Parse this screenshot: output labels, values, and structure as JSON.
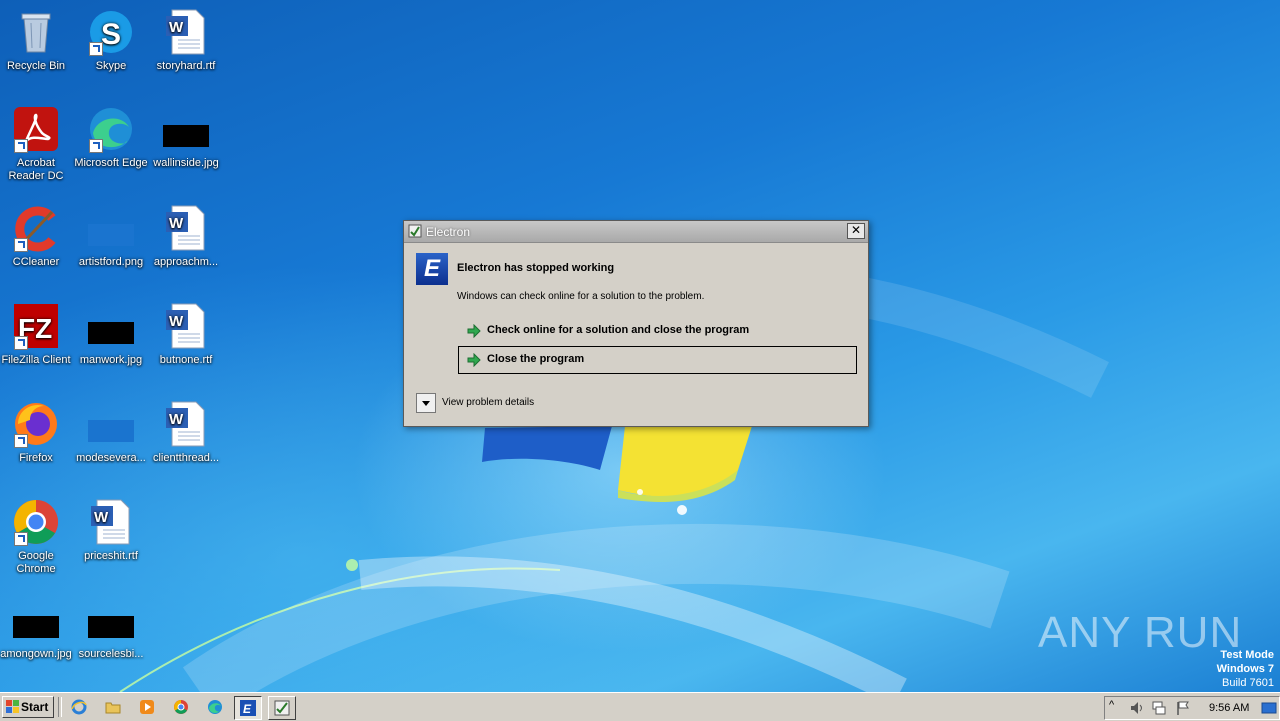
{
  "desktop": {
    "icons": [
      {
        "label": "Recycle Bin"
      },
      {
        "label": "Skype"
      },
      {
        "label": "storyhard.rtf"
      },
      {
        "label": "Acrobat Reader DC"
      },
      {
        "label": "Microsoft Edge"
      },
      {
        "label": "wallinside.jpg"
      },
      {
        "label": "CCleaner"
      },
      {
        "label": "artistford.png"
      },
      {
        "label": "approachm..."
      },
      {
        "label": "FileZilla Client"
      },
      {
        "label": "manwork.jpg"
      },
      {
        "label": "butnone.rtf"
      },
      {
        "label": "Firefox"
      },
      {
        "label": "modesevera..."
      },
      {
        "label": "clientthread..."
      },
      {
        "label": "Google Chrome"
      },
      {
        "label": "priceshit.rtf"
      },
      {
        "label": "amongown.jpg"
      },
      {
        "label": "sourcelesbi..."
      }
    ]
  },
  "dialog": {
    "title": "Electron",
    "close_glyph": "✕",
    "app_icon_letter": "E",
    "heading": "Electron has stopped working",
    "subtext": "Windows can check online for a solution to the problem.",
    "option_check": "Check online for a solution and close the program",
    "option_close": "Close the program",
    "details": "View problem details"
  },
  "watermark": {
    "brand": "ANY RUN",
    "mode_line1": "Test Mode",
    "mode_line2": "Windows 7",
    "mode_line3": "Build 7601"
  },
  "taskbar": {
    "start_label": "Start",
    "clock": "9:56 AM",
    "tray_expand": "^"
  },
  "colors": {
    "accent_green": "#2fa84f",
    "dialog_bg": "#d4d0c8",
    "electron_blue": "#1a4fb4"
  }
}
